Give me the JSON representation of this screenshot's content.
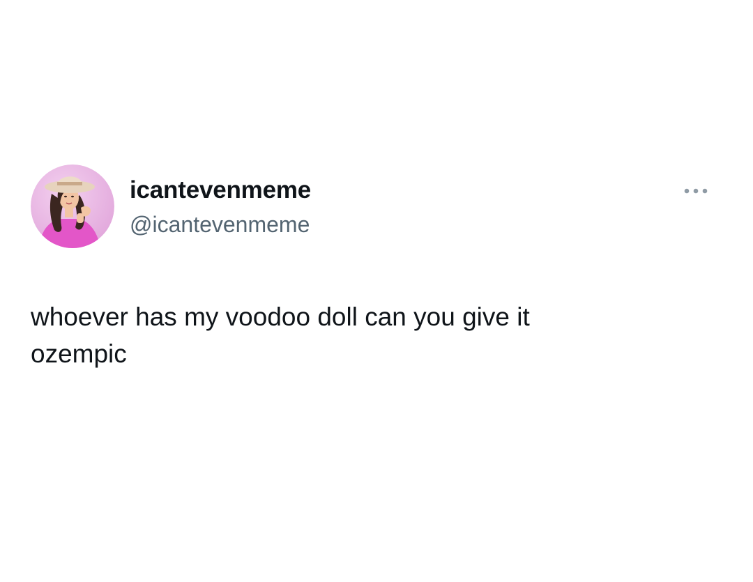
{
  "tweet": {
    "author": {
      "display_name": "icantevenmeme",
      "handle": "@icantevenmeme",
      "avatar_icon": "avatar-illustration-woman-in-sunhat"
    },
    "more_icon": "more-options-icon",
    "text": "whoever has my voodoo doll can you give it\nozempic"
  },
  "colors": {
    "background": "#ffffff",
    "text_primary": "#0f1419",
    "text_secondary": "#536471",
    "avatar_bg": "#e8b6e3",
    "shirt": "#e356c8",
    "hat": "#e7d3bd",
    "hair": "#3b2620",
    "skin": "#f2c5a4"
  }
}
